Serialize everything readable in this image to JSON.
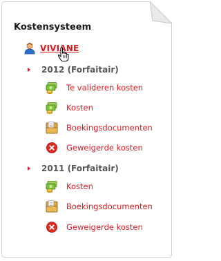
{
  "panel": {
    "title": "Kostensysteem",
    "user": {
      "name": "VIVIANE",
      "icon": "user-icon"
    },
    "years": [
      {
        "label": "2012 (Forfaitair)",
        "items": [
          {
            "label": "Te valideren kosten",
            "icon": "money-icon"
          },
          {
            "label": "Kosten",
            "icon": "money-icon"
          },
          {
            "label": "Boekingsdocumenten",
            "icon": "documents-icon"
          },
          {
            "label": "Geweigerde kosten",
            "icon": "rejected-icon"
          }
        ]
      },
      {
        "label": "2011 (Forfaitair)",
        "items": [
          {
            "label": "Kosten",
            "icon": "money-icon"
          },
          {
            "label": "Boekingsdocumenten",
            "icon": "documents-icon"
          },
          {
            "label": "Geweigerde kosten",
            "icon": "rejected-icon"
          }
        ]
      }
    ]
  },
  "colors": {
    "link": "#d9191f",
    "year": "#555555",
    "heading": "#1a1a1a"
  }
}
